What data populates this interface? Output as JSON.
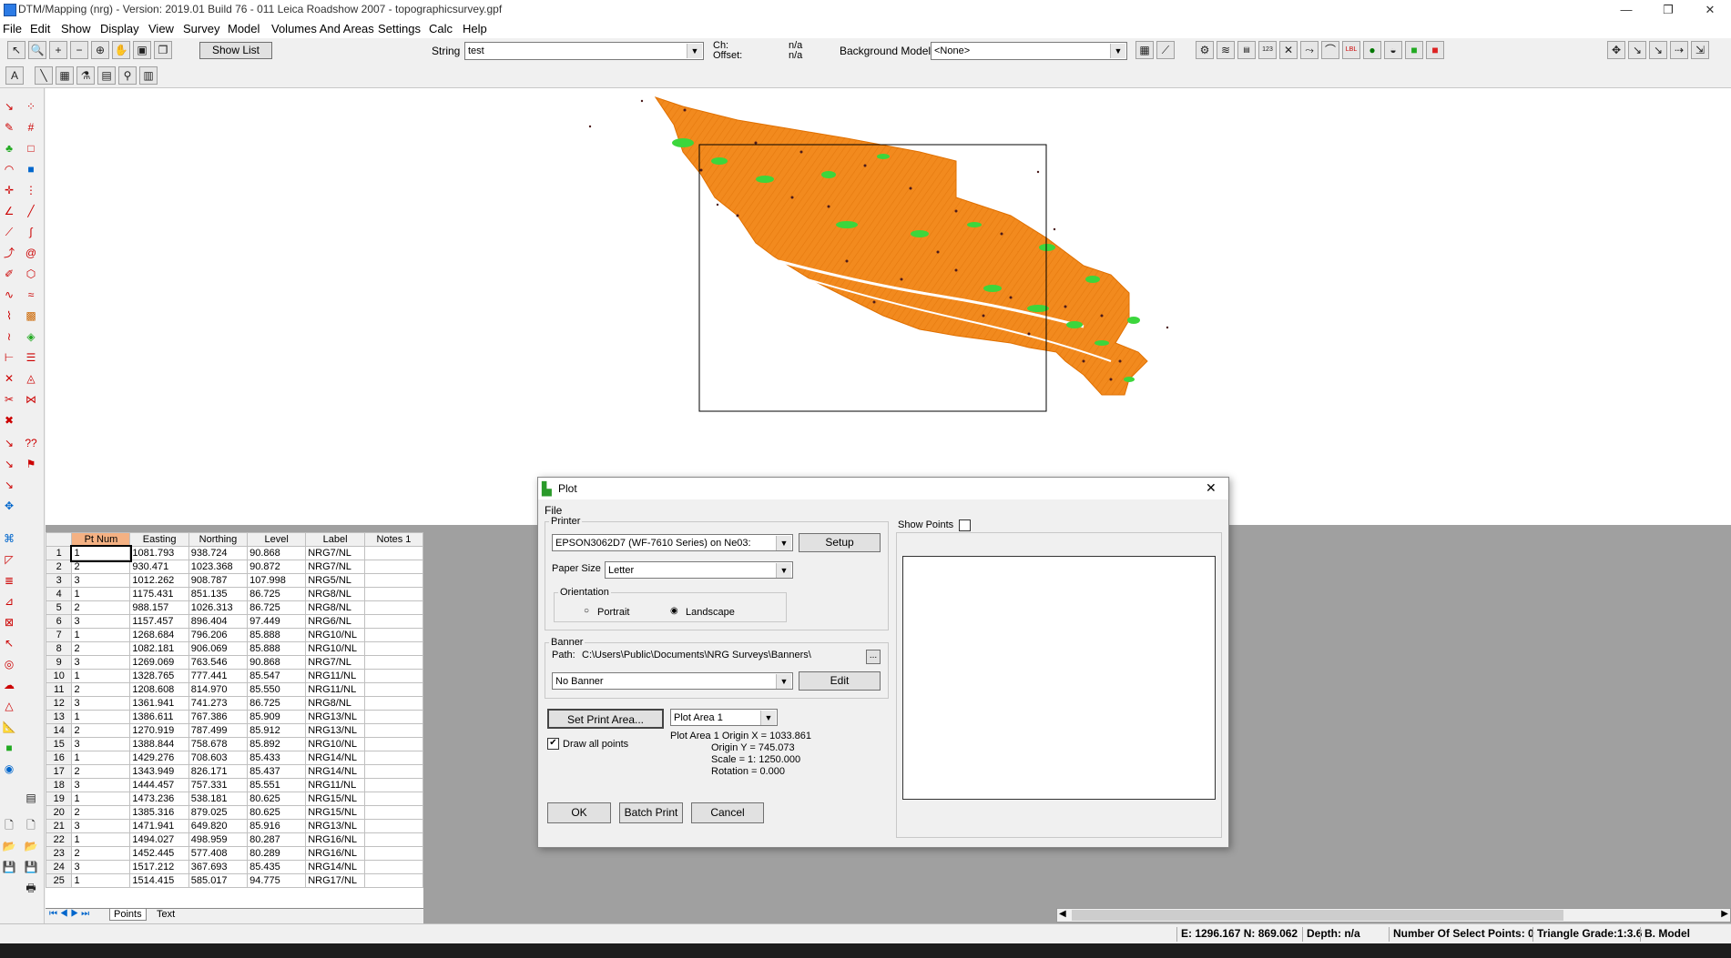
{
  "window": {
    "title": "DTM/Mapping (nrg) - Version: 2019.01 Build 76 - 011 Leica Roadshow 2007 - topographicsurvey.gpf",
    "minimize": "—",
    "restore": "❐",
    "close": "✕"
  },
  "menu": [
    "File",
    "Edit",
    "Show",
    "Display",
    "View",
    "Survey",
    "Model",
    "Volumes And Areas",
    "Settings",
    "Calc",
    "Help"
  ],
  "toolbar": {
    "show_list": "Show List",
    "string_label": "String",
    "string_value": "test",
    "ch_label": "Ch:",
    "ch_value": "n/a",
    "offset_label": "Offset:",
    "offset_value": "n/a",
    "background_label": "Background Model:",
    "background_value": "<None>"
  },
  "table": {
    "columns": [
      "Pt Num",
      "Easting",
      "Northing",
      "Level",
      "Label",
      "Notes 1"
    ],
    "rows": [
      [
        "1",
        "1",
        "1081.793",
        "938.724",
        "90.868",
        "NRG7/NL"
      ],
      [
        "2",
        "2",
        "930.471",
        "1023.368",
        "90.872",
        "NRG7/NL"
      ],
      [
        "3",
        "3",
        "1012.262",
        "908.787",
        "107.998",
        "NRG5/NL"
      ],
      [
        "4",
        "1",
        "1175.431",
        "851.135",
        "86.725",
        "NRG8/NL"
      ],
      [
        "5",
        "2",
        "988.157",
        "1026.313",
        "86.725",
        "NRG8/NL"
      ],
      [
        "6",
        "3",
        "1157.457",
        "896.404",
        "97.449",
        "NRG6/NL"
      ],
      [
        "7",
        "1",
        "1268.684",
        "796.206",
        "85.888",
        "NRG10/NL"
      ],
      [
        "8",
        "2",
        "1082.181",
        "906.069",
        "85.888",
        "NRG10/NL"
      ],
      [
        "9",
        "3",
        "1269.069",
        "763.546",
        "90.868",
        "NRG7/NL"
      ],
      [
        "10",
        "1",
        "1328.765",
        "777.441",
        "85.547",
        "NRG11/NL"
      ],
      [
        "11",
        "2",
        "1208.608",
        "814.970",
        "85.550",
        "NRG11/NL"
      ],
      [
        "12",
        "3",
        "1361.941",
        "741.273",
        "86.725",
        "NRG8/NL"
      ],
      [
        "13",
        "1",
        "1386.611",
        "767.386",
        "85.909",
        "NRG13/NL"
      ],
      [
        "14",
        "2",
        "1270.919",
        "787.499",
        "85.912",
        "NRG13/NL"
      ],
      [
        "15",
        "3",
        "1388.844",
        "758.678",
        "85.892",
        "NRG10/NL"
      ],
      [
        "16",
        "1",
        "1429.276",
        "708.603",
        "85.433",
        "NRG14/NL"
      ],
      [
        "17",
        "2",
        "1343.949",
        "826.171",
        "85.437",
        "NRG14/NL"
      ],
      [
        "18",
        "3",
        "1444.457",
        "757.331",
        "85.551",
        "NRG11/NL"
      ],
      [
        "19",
        "1",
        "1473.236",
        "538.181",
        "80.625",
        "NRG15/NL"
      ],
      [
        "20",
        "2",
        "1385.316",
        "879.025",
        "80.625",
        "NRG15/NL"
      ],
      [
        "21",
        "3",
        "1471.941",
        "649.820",
        "85.916",
        "NRG13/NL"
      ],
      [
        "22",
        "1",
        "1494.027",
        "498.959",
        "80.287",
        "NRG16/NL"
      ],
      [
        "23",
        "2",
        "1452.445",
        "577.408",
        "80.289",
        "NRG16/NL"
      ],
      [
        "24",
        "3",
        "1517.212",
        "367.693",
        "85.435",
        "NRG14/NL"
      ],
      [
        "25",
        "1",
        "1514.415",
        "585.017",
        "94.775",
        "NRG17/NL"
      ]
    ],
    "tabs": [
      "Points",
      "Text"
    ]
  },
  "dialog": {
    "title": "Plot",
    "menu": "File",
    "close": "✕",
    "printer_group": "Printer",
    "printer_value": "EPSON3062D7 (WF-7610 Series) on Ne03:",
    "setup": "Setup",
    "paper_label": "Paper Size",
    "paper_value": "Letter",
    "orientation_group": "Orientation",
    "portrait": "Portrait",
    "landscape": "Landscape",
    "banner_group": "Banner",
    "path_label": "Path:",
    "path_value": "C:\\Users\\Public\\Documents\\NRG Surveys\\Banners\\",
    "browse": "...",
    "banner_value": "No Banner",
    "edit": "Edit",
    "set_print_area": "Set Print Area...",
    "plot_area_value": "Plot Area 1",
    "info1": "Plot Area 1   Origin X = 1033.861",
    "info2": "Origin Y = 745.073",
    "info3": "Scale = 1: 1250.000",
    "info4": "Rotation = 0.000",
    "draw_all": "Draw all points",
    "ok": "OK",
    "batch": "Batch Print",
    "cancel": "Cancel",
    "show_points": "Show Points"
  },
  "status": {
    "coords": "E: 1296.167  N: 869.062",
    "depth": "Depth: n/a",
    "select": "Number Of Select Points: 0",
    "triangle": "Triangle Grade:1:3.6",
    "model": "B. Model"
  },
  "colors": {
    "mesh": "#f28a1e",
    "vegetation": "#3cd63c",
    "points": "#4a1a1a"
  }
}
